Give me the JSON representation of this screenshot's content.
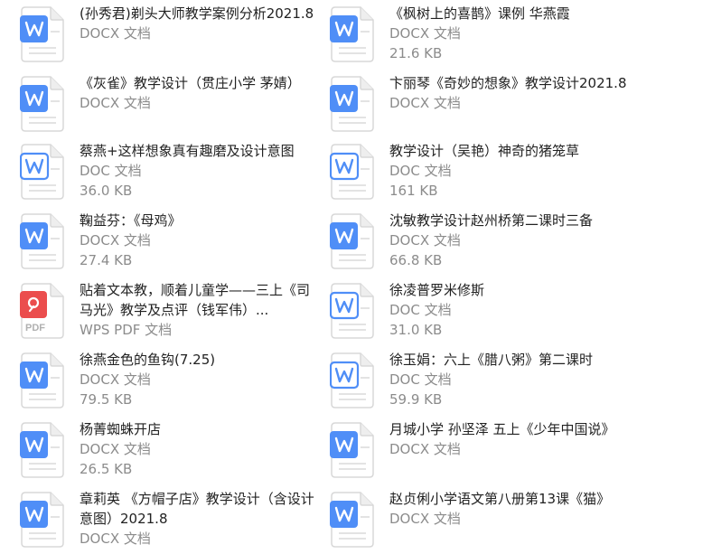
{
  "colors": {
    "word_blue": "#4f8ef7",
    "word_blue_dark": "#3d77e0",
    "pdf_red": "#eb4d4d",
    "page_fill": "#ffffff",
    "page_border": "#d8d8d8",
    "name_text": "#222222",
    "meta_text": "#8c8c8c"
  },
  "files": [
    {
      "name": "(孙秀君)剃头大师教学案例分析2021.8",
      "type": "DOCX 文档",
      "size": "",
      "icon": "docx-icon"
    },
    {
      "name": "《枫树上的喜鹊》课例  华燕霞",
      "type": "DOCX 文档",
      "size": "21.6 KB",
      "icon": "docx-icon"
    },
    {
      "name": "《灰雀》教学设计（贯庄小学 茅婧）",
      "type": "DOCX 文档",
      "size": "",
      "icon": "docx-icon"
    },
    {
      "name": "卞丽琴《奇妙的想象》教学设计2021.8",
      "type": "DOCX 文档",
      "size": "",
      "icon": "docx-icon"
    },
    {
      "name": "蔡燕+这样想象真有趣磨及设计意图",
      "type": "DOC 文档",
      "size": "36.0 KB",
      "icon": "doc-icon"
    },
    {
      "name": "教学设计（吴艳）神奇的猪笼草",
      "type": "DOC 文档",
      "size": "161 KB",
      "icon": "doc-icon"
    },
    {
      "name": "鞠益芬：《母鸡》",
      "type": "DOCX 文档",
      "size": "27.4 KB",
      "icon": "docx-icon"
    },
    {
      "name": "沈敏教学设计赵州桥第二课时三备",
      "type": "DOCX 文档",
      "size": "66.8 KB",
      "icon": "docx-icon"
    },
    {
      "name": "贴着文本教，顺着儿童学——三上《司马光》教学及点评（钱军伟）...",
      "type": "WPS PDF 文档",
      "size": "",
      "icon": "pdf-icon"
    },
    {
      "name": "徐凌普罗米修斯",
      "type": "DOC 文档",
      "size": "31.0 KB",
      "icon": "doc-icon"
    },
    {
      "name": "徐燕金色的鱼钩(7.25)",
      "type": "DOCX 文档",
      "size": "79.5 KB",
      "icon": "docx-icon"
    },
    {
      "name": "徐玉娟：六上《腊八粥》第二课时",
      "type": "DOC 文档",
      "size": "59.9 KB",
      "icon": "doc-icon"
    },
    {
      "name": "杨菁蜘蛛开店",
      "type": "DOCX 文档",
      "size": "26.5 KB",
      "icon": "docx-icon"
    },
    {
      "name": "月城小学 孙坚泽 五上《少年中国说》",
      "type": "DOCX 文档",
      "size": "",
      "icon": "docx-icon"
    },
    {
      "name": "章莉英 《方帽子店》教学设计（含设计意图）2021.8",
      "type": "DOCX 文档",
      "size": "",
      "icon": "docx-icon"
    },
    {
      "name": "赵贞俐小学语文第八册第13课《猫》",
      "type": "DOCX 文档",
      "size": "",
      "icon": "docx-icon"
    }
  ]
}
